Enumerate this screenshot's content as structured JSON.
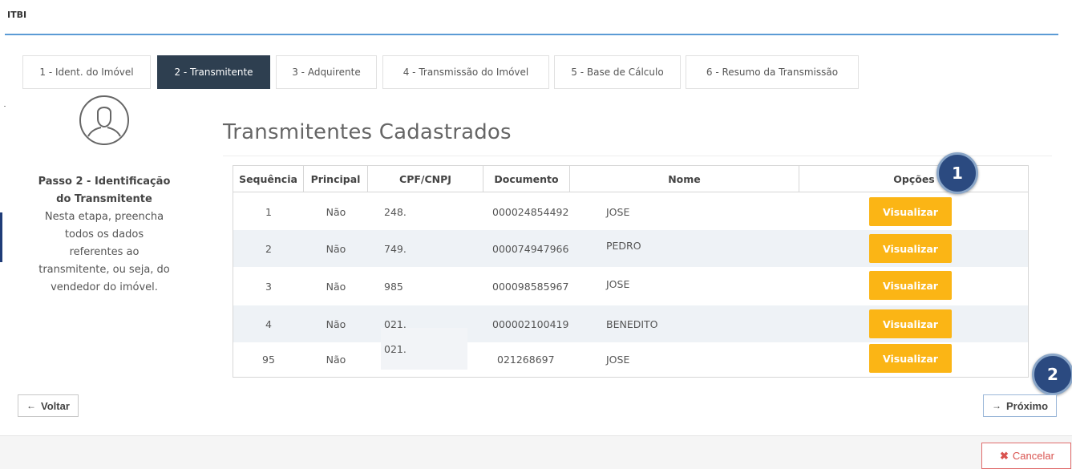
{
  "app": {
    "title": "ITBI"
  },
  "tabs": [
    {
      "label": "1 - Ident. do Imóvel",
      "active": false
    },
    {
      "label": "2 - Transmitente",
      "active": true
    },
    {
      "label": "3 - Adquirente",
      "active": false
    },
    {
      "label": "4 - Transmissão do Imóvel",
      "active": false
    },
    {
      "label": "5 - Base de Cálculo",
      "active": false
    },
    {
      "label": "6 - Resumo da Transmissão",
      "active": false
    }
  ],
  "sidebar": {
    "avatar_icon": "user-circle-icon",
    "step_title_line1": "Passo 2 - Identificação",
    "step_title_line2": "do Transmitente",
    "desc_lines": [
      "Nesta etapa, preencha",
      "todos os dados",
      "referentes ao",
      "transmitente, ou seja, do",
      "vendedor do imóvel."
    ]
  },
  "section": {
    "title": "Transmitentes Cadastrados"
  },
  "table": {
    "headers": [
      "Sequência",
      "Principal",
      "CPF/CNPJ",
      "Documento",
      "Nome",
      "Opções"
    ],
    "rows": [
      {
        "seq": "1",
        "principal": "Não",
        "cpf": "248.",
        "documento": "000024854492",
        "nome": "JOSE",
        "action": "Visualizar"
      },
      {
        "seq": "2",
        "principal": "Não",
        "cpf": "749.",
        "documento": "000074947966",
        "nome": "PEDRO",
        "action": "Visualizar"
      },
      {
        "seq": "3",
        "principal": "Não",
        "cpf": "985",
        "documento": "000098585967",
        "nome": "JOSE",
        "action": "Visualizar"
      },
      {
        "seq": "4",
        "principal": "Não",
        "cpf": "021.",
        "documento": "000002100419",
        "nome": "BENEDITO",
        "action": "Visualizar"
      },
      {
        "seq": "95",
        "principal": "Não",
        "cpf": "021.",
        "documento": "021268697",
        "nome": "JOSE",
        "action": "Visualizar"
      }
    ]
  },
  "annotations": {
    "badge1": "1",
    "badge2": "2"
  },
  "nav": {
    "back_label": "Voltar",
    "back_icon": "arrow-left-icon",
    "next_label": "Próximo",
    "next_icon": "arrow-right-icon",
    "cancel_label": "Cancelar",
    "cancel_icon": "close-icon"
  },
  "colors": {
    "active_tab": "#2e3f50",
    "action_button": "#fbb515",
    "accent_rule": "#5b9bd5",
    "badge": "#2b4a80",
    "cancel": "#d9534f"
  }
}
